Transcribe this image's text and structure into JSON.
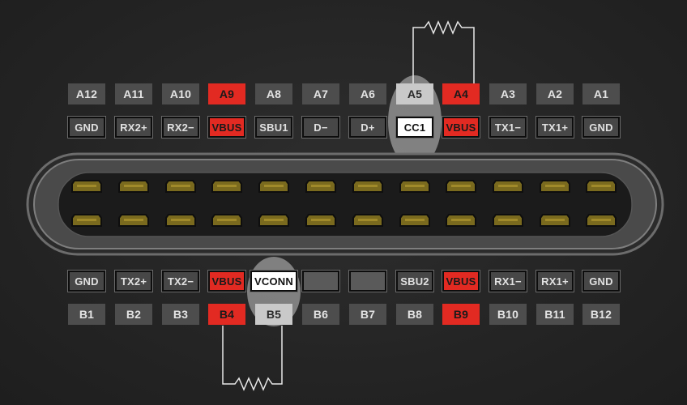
{
  "row_a_numbers": [
    "A12",
    "A11",
    "A10",
    "A9",
    "A8",
    "A7",
    "A6",
    "A5",
    "A4",
    "A3",
    "A2",
    "A1"
  ],
  "row_a_signals": [
    "GND",
    "RX2+",
    "RX2−",
    "VBUS",
    "SBU1",
    "D−",
    "D+",
    "CC1",
    "VBUS",
    "TX1−",
    "TX1+",
    "GND"
  ],
  "row_b_signals": [
    "GND",
    "TX2+",
    "TX2−",
    "VBUS",
    "VCONN",
    "",
    "",
    "SBU2",
    "VBUS",
    "RX1−",
    "RX1+",
    "GND"
  ],
  "row_b_numbers": [
    "B1",
    "B2",
    "B3",
    "B4",
    "B5",
    "B6",
    "B7",
    "B8",
    "B9",
    "B10",
    "B11",
    "B12"
  ],
  "colors": {
    "vbus_red": "#e22a22",
    "pin_gold": "#7a6a1e",
    "connector_shell": "#7a7a7a",
    "background": "#262626"
  },
  "icons": [
    "resistor-icon"
  ]
}
